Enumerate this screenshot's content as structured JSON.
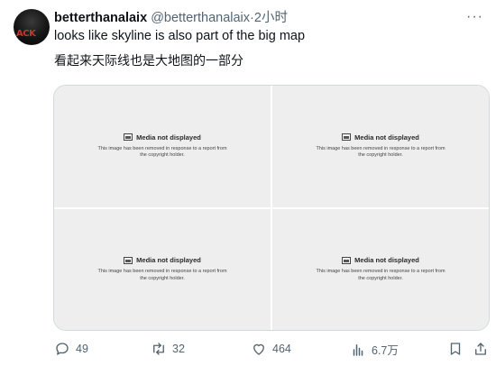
{
  "tweet": {
    "display_name": "betterthanalaix",
    "handle": "@betterthanalaix",
    "separator": "·",
    "time": "2小时",
    "more_label": "···",
    "avatar_text": "ACK",
    "text_line1": "looks like skyline is also part of the big map",
    "text_line2": "看起来天际线也是大地图的一部分"
  },
  "media": [
    {
      "title": "Media not displayed",
      "description": "This image has been removed in response to a report from the copyright holder."
    },
    {
      "title": "Media not displayed",
      "description": "This image has been removed in response to a report from the copyright holder."
    },
    {
      "title": "Media not displayed",
      "description": "This image has been removed in response to a report from the copyright holder."
    },
    {
      "title": "Media not displayed",
      "description": "This image has been removed in response to a report from the copyright holder."
    }
  ],
  "actions": {
    "replies": "49",
    "reposts": "32",
    "likes": "464",
    "views": "6.7万",
    "icons": [
      "reply-icon",
      "retweet-icon",
      "heart-icon",
      "views-chart-icon",
      "bookmark-icon",
      "share-icon"
    ]
  },
  "colors": {
    "text": "#0f1419",
    "secondary": "#536471",
    "border": "#cfd9de",
    "media_bg": "#eeeeee"
  }
}
